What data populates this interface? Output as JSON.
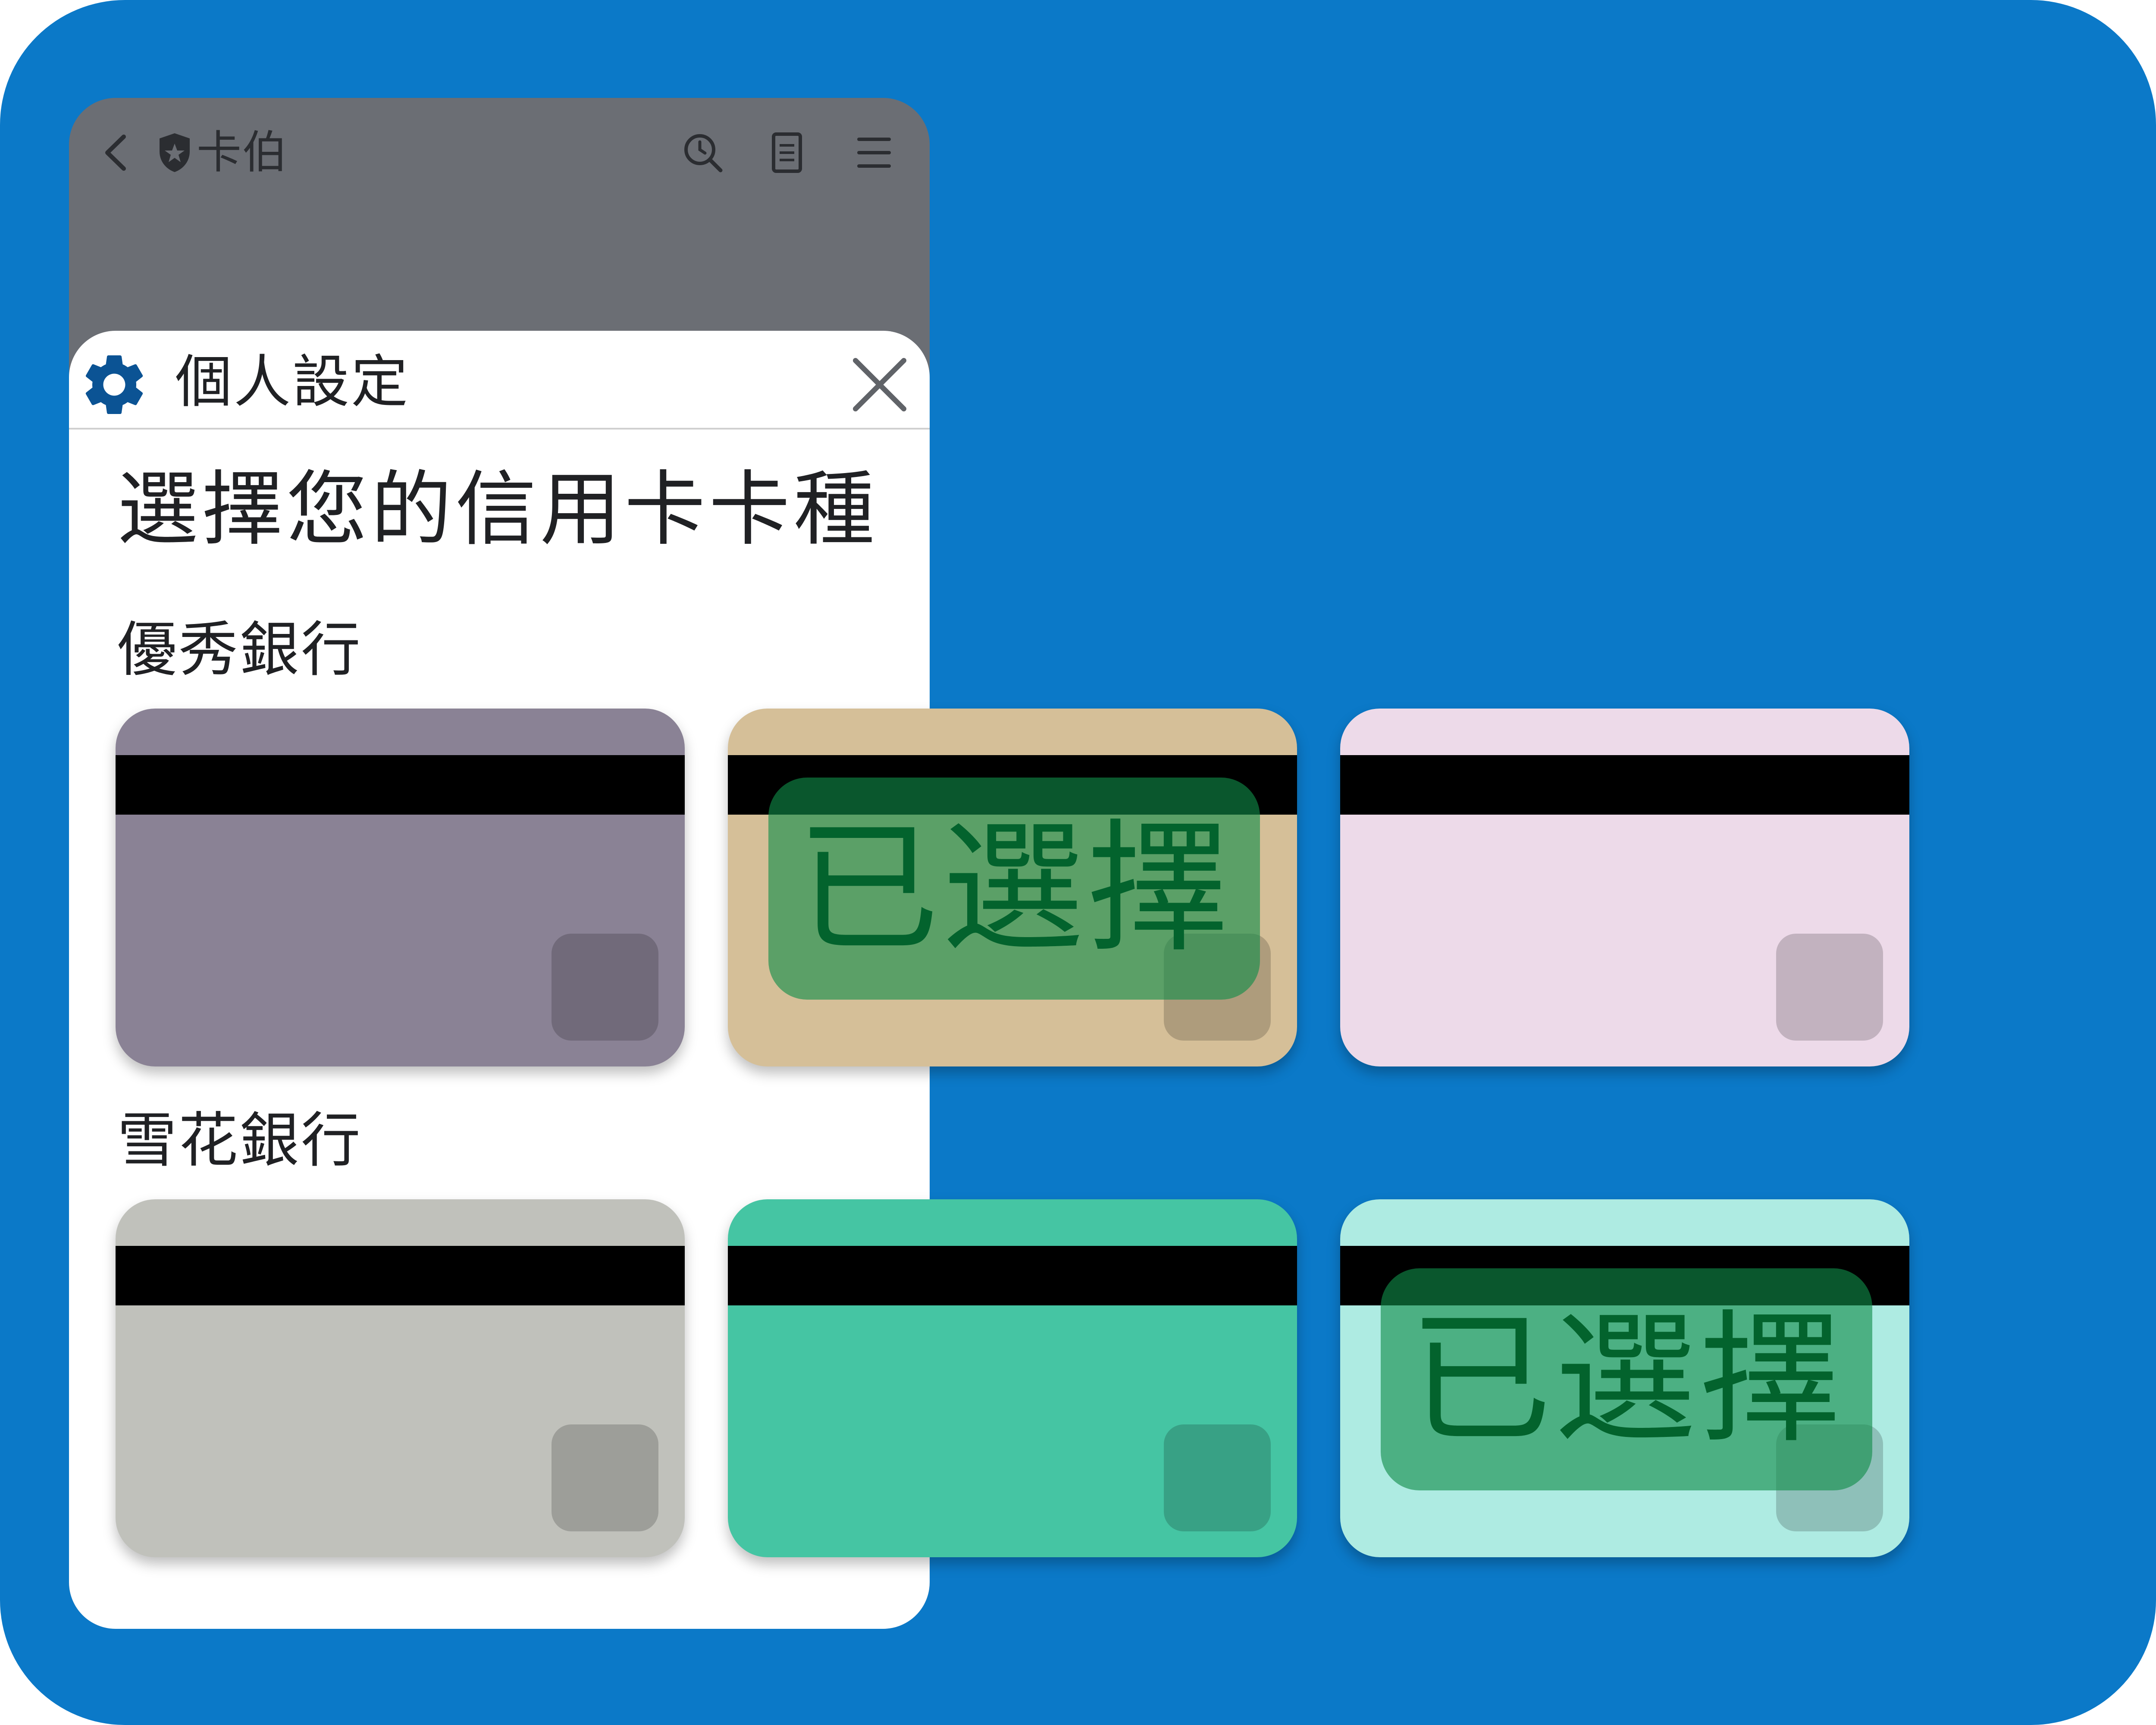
{
  "browser": {
    "site_title": "卡伯",
    "icons": {
      "back": "chevron-left-icon",
      "shield": "shield-star-icon",
      "search": "search-history-icon",
      "reader": "reader-mode-icon",
      "menu": "hamburger-menu-icon"
    }
  },
  "sheet": {
    "title": "個人設定",
    "question": "選擇您的信用卡卡種",
    "icons": {
      "settings": "gear-icon",
      "close": "close-icon"
    }
  },
  "banks": [
    {
      "name": "優秀銀行",
      "cards": [
        {
          "color": "#8A8295",
          "selected": false
        },
        {
          "color": "#D5BF98",
          "selected": true,
          "badge": "已選擇"
        },
        {
          "color": "#EDDAE9",
          "selected": false
        }
      ]
    },
    {
      "name": "雪花銀行",
      "cards": [
        {
          "color": "#C0C1BB",
          "selected": false
        },
        {
          "color": "#45C5A3",
          "selected": false
        },
        {
          "color": "#AEEBE2",
          "selected": true,
          "badge": "已選擇"
        }
      ]
    }
  ],
  "colors": {
    "background": "#0B79C8",
    "browser_dim": "#6B6E74",
    "accent_blue": "#0B5394",
    "badge_text": "#03632D"
  }
}
